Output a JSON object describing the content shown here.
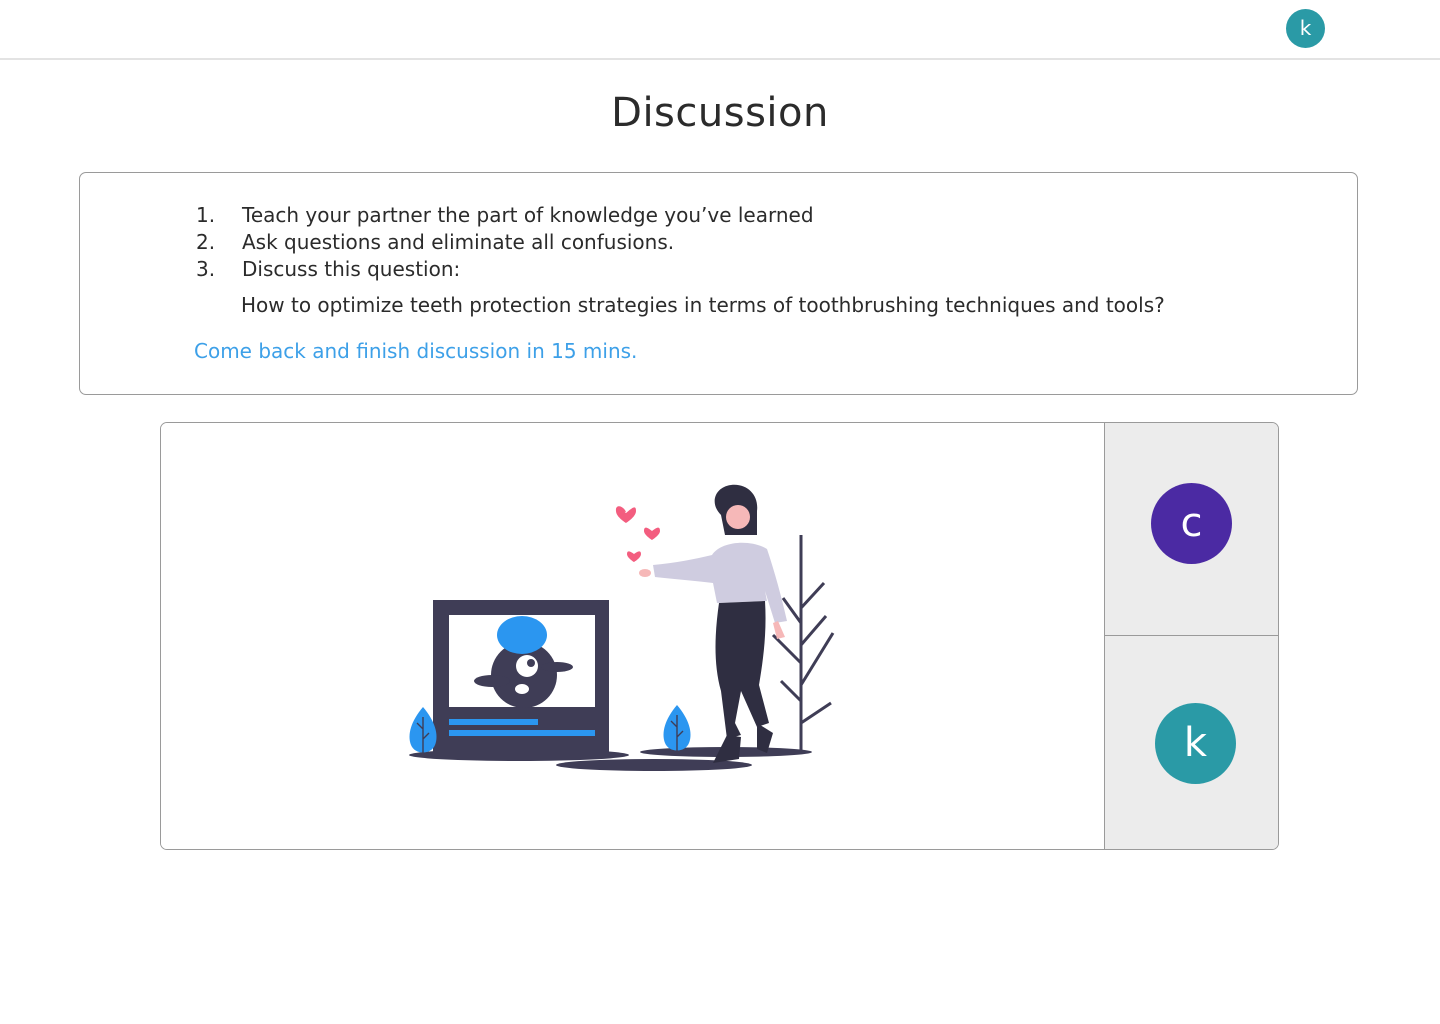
{
  "header": {
    "avatar": {
      "initial": "k",
      "color": "#2a9aa6"
    }
  },
  "page": {
    "title": "Discussion"
  },
  "instructions": {
    "steps": [
      {
        "number": "1.",
        "text": "Teach your partner the part of knowledge you’ve learned"
      },
      {
        "number": "2.",
        "text": "Ask questions and eliminate all confusions."
      },
      {
        "number": "3.",
        "text": "Discuss this question:"
      }
    ],
    "question": "How to optimize teeth protection strategies in terms of toothbrushing techniques and tools?",
    "reminder": "Come back and finish discussion in 15 mins.",
    "reminder_color": "#3da0e8"
  },
  "participants": [
    {
      "initial": "c",
      "color": "#4b2aa3"
    },
    {
      "initial": "k",
      "color": "#2a9aa6"
    }
  ],
  "illustration": {
    "name": "waiting-illustration",
    "colors": {
      "accent": "#2b96f0",
      "dark": "#3f3d56",
      "heart": "#f35d7f",
      "shirt": "#cfcce0"
    }
  }
}
